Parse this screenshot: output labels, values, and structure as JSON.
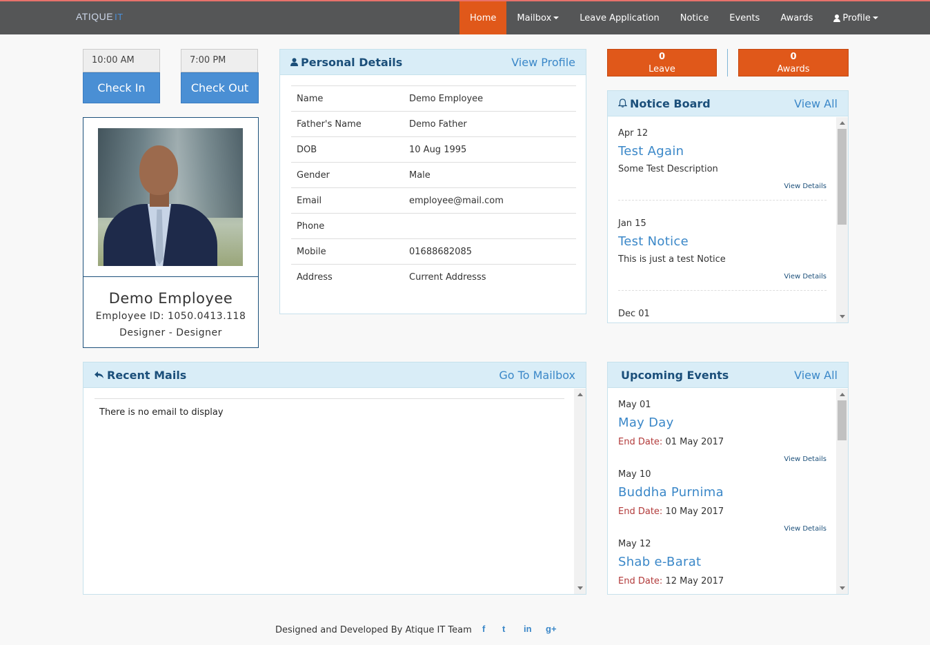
{
  "brand": {
    "logo_main": "ATIQUE",
    "logo_suffix": "IT"
  },
  "nav": {
    "home": "Home",
    "mailbox": "Mailbox",
    "leave": "Leave Application",
    "notice": "Notice",
    "events": "Events",
    "awards": "Awards",
    "profile": "Profile"
  },
  "attendance": {
    "check_in_time": "10:00 AM",
    "check_out_time": "7:00 PM",
    "check_in_label": "Check In",
    "check_out_label": "Check Out"
  },
  "profile": {
    "name": "Demo Employee",
    "employee_id": "Employee ID: 1050.0413.118",
    "designation": "Designer - Designer"
  },
  "personal_details": {
    "title": "Personal Details",
    "link": "View Profile",
    "rows": [
      {
        "key": "Name",
        "value": "Demo Employee"
      },
      {
        "key": "Father's Name",
        "value": "Demo Father"
      },
      {
        "key": "DOB",
        "value": "10 Aug 1995"
      },
      {
        "key": "Gender",
        "value": "Male"
      },
      {
        "key": "Email",
        "value": "employee@mail.com"
      },
      {
        "key": "Phone",
        "value": ""
      },
      {
        "key": "Mobile",
        "value": "01688682085"
      },
      {
        "key": "Address",
        "value": "Current Addresss"
      }
    ]
  },
  "counters": {
    "leave": {
      "count": "0",
      "label": "Leave"
    },
    "awards": {
      "count": "0",
      "label": "Awards"
    }
  },
  "notice_board": {
    "title": "Notice Board",
    "link": "View All",
    "items": [
      {
        "date": "Apr 12",
        "title": "Test Again",
        "description": "Some Test Description",
        "link": "View Details"
      },
      {
        "date": "Jan 15",
        "title": "Test Notice",
        "description": "This is just a test Notice",
        "link": "View Details"
      },
      {
        "date": "Dec 01"
      }
    ]
  },
  "recent_mails": {
    "title": "Recent Mails",
    "link": "Go To Mailbox",
    "empty_text": "There is no email to display"
  },
  "upcoming_events": {
    "title": "Upcoming Events",
    "link": "View All",
    "end_label": "End Date:",
    "items": [
      {
        "date": "May 01",
        "title": "May Day",
        "end_date": "01 May 2017",
        "link": "View Details"
      },
      {
        "date": "May 10",
        "title": "Buddha Purnima",
        "end_date": "10 May 2017",
        "link": "View Details"
      },
      {
        "date": "May 12",
        "title": "Shab e-Barat",
        "end_date": "12 May 2017"
      }
    ]
  },
  "footer": {
    "text": "Designed and Developed By Atique IT Team",
    "social": {
      "facebook": "f",
      "twitter": "t",
      "linkedin": "in",
      "google_plus": "g+"
    }
  },
  "colors": {
    "navbar": "#555657",
    "active_orange": "#e0581a",
    "button_blue": "#4a8fd4",
    "panel_header": "#d9edf7",
    "link_blue": "#3a87c8",
    "title_navy": "#1b4f7a",
    "end_date_red": "#b23a3a"
  }
}
